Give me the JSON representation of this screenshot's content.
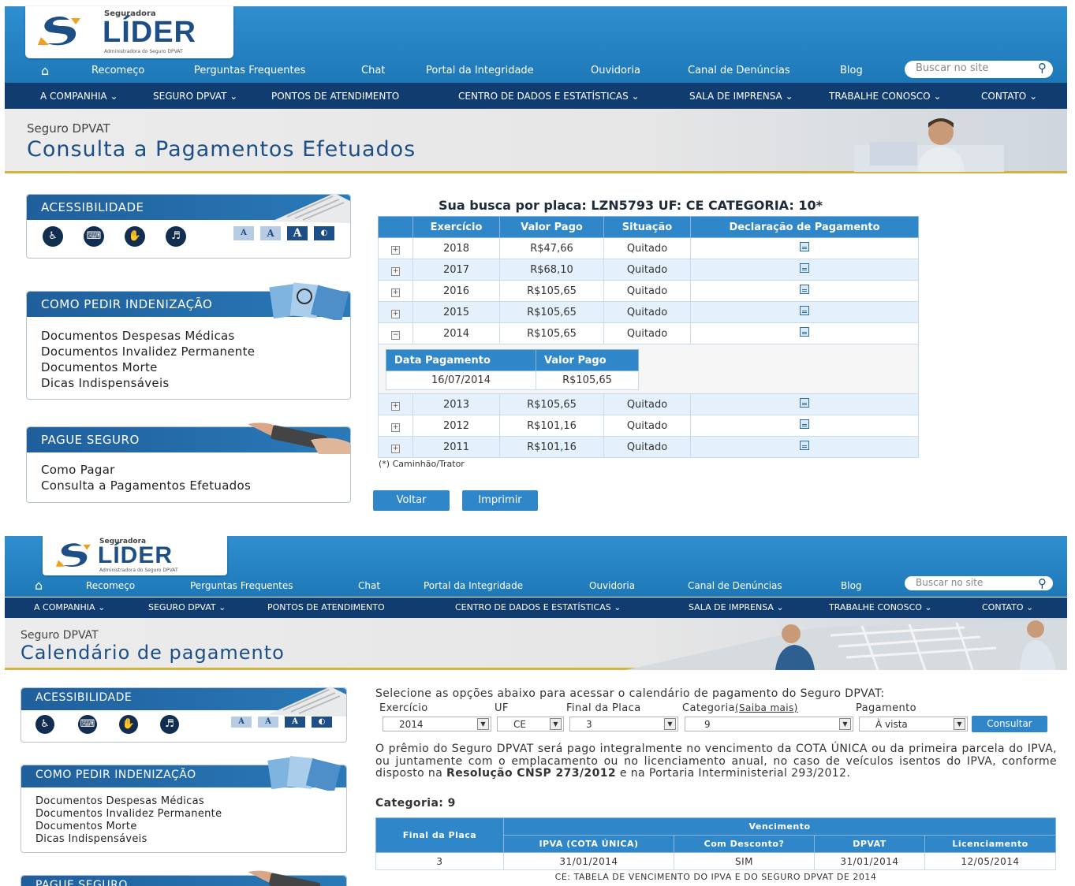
{
  "site": {
    "brand_top": "Seguradora",
    "brand_name": "LÍDER",
    "brand_sub": "Administradora do Seguro DPVAT",
    "top_nav": [
      "Recomeço",
      "Perguntas Frequentes",
      "Chat",
      "Portal da Integridade",
      "Ouvidoria",
      "Canal de Denúncias",
      "Blog"
    ],
    "search_placeholder": "Buscar no site",
    "main_nav": [
      "A COMPANHIA",
      "SEGURO DPVAT",
      "PONTOS DE ATENDIMENTO",
      "CENTRO DE DADOS E ESTATÍSTICAS",
      "SALA DE IMPRENSA",
      "TRABALHE CONOSCO",
      "CONTATO"
    ]
  },
  "sidebar": {
    "acc_title": "ACESSIBILIDADE",
    "font_buttons": [
      "A",
      "A",
      "A"
    ],
    "indenizacao_title": "COMO PEDIR INDENIZAÇÃO",
    "indenizacao_links": [
      "Documentos Despesas Médicas",
      "Documentos Invalidez Permanente",
      "Documentos Morte",
      "Dicas Indispensáveis"
    ],
    "pague_title": "PAGUE SEGURO",
    "pague_links": [
      "Como Pagar",
      "Consulta a Pagamentos Efetuados"
    ]
  },
  "page1": {
    "subtitle": "Seguro DPVAT",
    "title": "Consulta a Pagamentos Efetuados",
    "result_title": "Sua busca por placa: LZN5793 UF: CE CATEGORIA: 10*",
    "columns": [
      "Exercício",
      "Valor Pago",
      "Situação",
      "Declaração de Pagamento"
    ],
    "rows": [
      [
        "2018",
        "R$47,66",
        "Quitado"
      ],
      [
        "2017",
        "R$68,10",
        "Quitado"
      ],
      [
        "2016",
        "R$105,65",
        "Quitado"
      ],
      [
        "2015",
        "R$105,65",
        "Quitado"
      ],
      [
        "2014",
        "R$105,65",
        "Quitado"
      ],
      [
        "2013",
        "R$105,65",
        "Quitado"
      ],
      [
        "2012",
        "R$101,16",
        "Quitado"
      ],
      [
        "2011",
        "R$101,16",
        "Quitado"
      ]
    ],
    "detail_columns": [
      "Data Pagamento",
      "Valor Pago"
    ],
    "detail_row": [
      "16/07/2014",
      "R$105,65"
    ],
    "note": "(*) Caminhão/Trator",
    "btn_back": "Voltar",
    "btn_print": "Imprimir"
  },
  "page2": {
    "subtitle": "Seguro DPVAT",
    "title": "Calendário de pagamento",
    "intro": "Selecione as opções abaixo para acessar o calendário de pagamento do Seguro DPVAT:",
    "labels": {
      "exercicio": "Exercício",
      "uf": "UF",
      "final": "Final da Placa",
      "categoria": "Categoria",
      "saiba": "(Saiba mais)",
      "pagamento": "Pagamento"
    },
    "values": {
      "exercicio": "2014",
      "uf": "CE",
      "final": "3",
      "categoria": "9",
      "pagamento": "À vista"
    },
    "btn_consultar": "Consultar",
    "para_1": "O prêmio do Seguro DPVAT será pago integralmente no vencimento da COTA ÚNICA ou da primeira parcela do IPVA, ou juntamente com o emplacamento ou no licenciamento anual, no caso de veículos isentos do IPVA, conforme disposto na",
    "para_bold": "Resolução CNSP 273/2012",
    "para_2": "e na Portaria Interministerial 293/2012.",
    "categoria_label": "Categoria: 9",
    "cal_headers": {
      "final": "Final da Placa",
      "venc": "Vencimento",
      "ipva": "IPVA (COTA ÚNICA)",
      "desconto": "Com Desconto?",
      "dpvat": "DPVAT",
      "lic": "Licenciamento"
    },
    "cal_row": [
      "3",
      "31/01/2014",
      "SIM",
      "31/01/2014",
      "12/05/2014"
    ],
    "cal_caption": "CE: TABELA DE VENCIMENTO DO IPVA E DO SEGURO DPVAT DE 2014"
  }
}
